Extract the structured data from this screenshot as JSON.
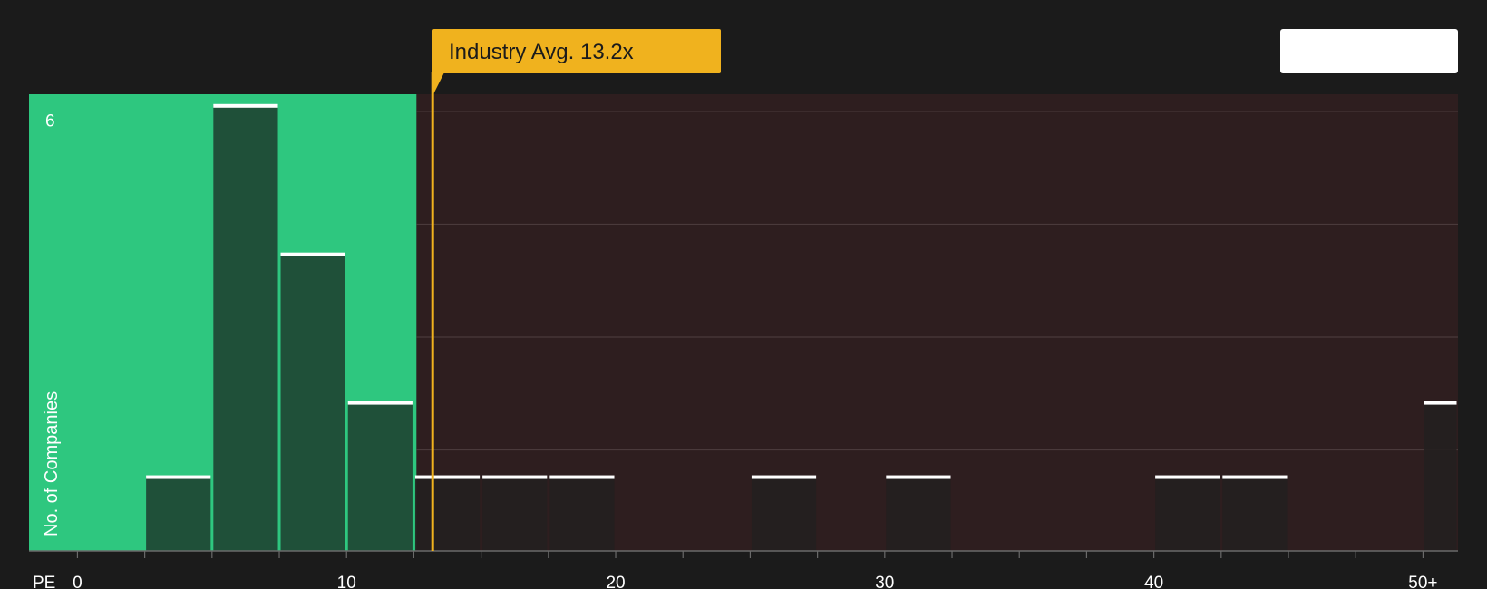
{
  "chart_data": {
    "type": "bar",
    "x_axis_prefix": "PE",
    "ylabel": "No. of Companies",
    "x_tick_labels": [
      "0",
      "10",
      "20",
      "30",
      "40",
      "50+"
    ],
    "x_tick_values": [
      0,
      10,
      20,
      30,
      40,
      50
    ],
    "y_tick_labels": [
      "6"
    ],
    "ylim": [
      0,
      6.15
    ],
    "xlim": [
      -1.8,
      51.3
    ],
    "bin_width": 2.5,
    "bins": [
      {
        "x0": 2.5,
        "x1": 5.0,
        "count": 1
      },
      {
        "x0": 5.0,
        "x1": 7.5,
        "count": 6
      },
      {
        "x0": 7.5,
        "x1": 10.0,
        "count": 4
      },
      {
        "x0": 10.0,
        "x1": 12.5,
        "count": 2
      },
      {
        "x0": 12.5,
        "x1": 15.0,
        "count": 1
      },
      {
        "x0": 15.0,
        "x1": 17.5,
        "count": 1
      },
      {
        "x0": 17.5,
        "x1": 20.0,
        "count": 1
      },
      {
        "x0": 25.0,
        "x1": 27.5,
        "count": 1
      },
      {
        "x0": 30.0,
        "x1": 32.5,
        "count": 1
      },
      {
        "x0": 40.0,
        "x1": 42.5,
        "count": 1
      },
      {
        "x0": 42.5,
        "x1": 45.0,
        "count": 1
      },
      {
        "x0": 50.0,
        "x1": 51.3,
        "count": 2
      }
    ],
    "highlight_range": [
      -1.8,
      12.6
    ],
    "industry_avg": {
      "value": 13.2,
      "label": "Industry Avg. 13.2x"
    },
    "grid": true,
    "legend_placement": "top-right"
  },
  "colors": {
    "background": "#1b1b1b",
    "good_zone": "#2ec77f",
    "bad_zone": "#2e1e1f",
    "bar_good": "#1f4a36",
    "bar_bad": "#231f1f",
    "bar_top": "#ffffff",
    "avg_line": "#f0b21e",
    "callout_bg": "#f0b21e",
    "callout_text": "#1b1b1b",
    "grid": "#4a3a3b",
    "legend_bg": "#ffffff"
  }
}
